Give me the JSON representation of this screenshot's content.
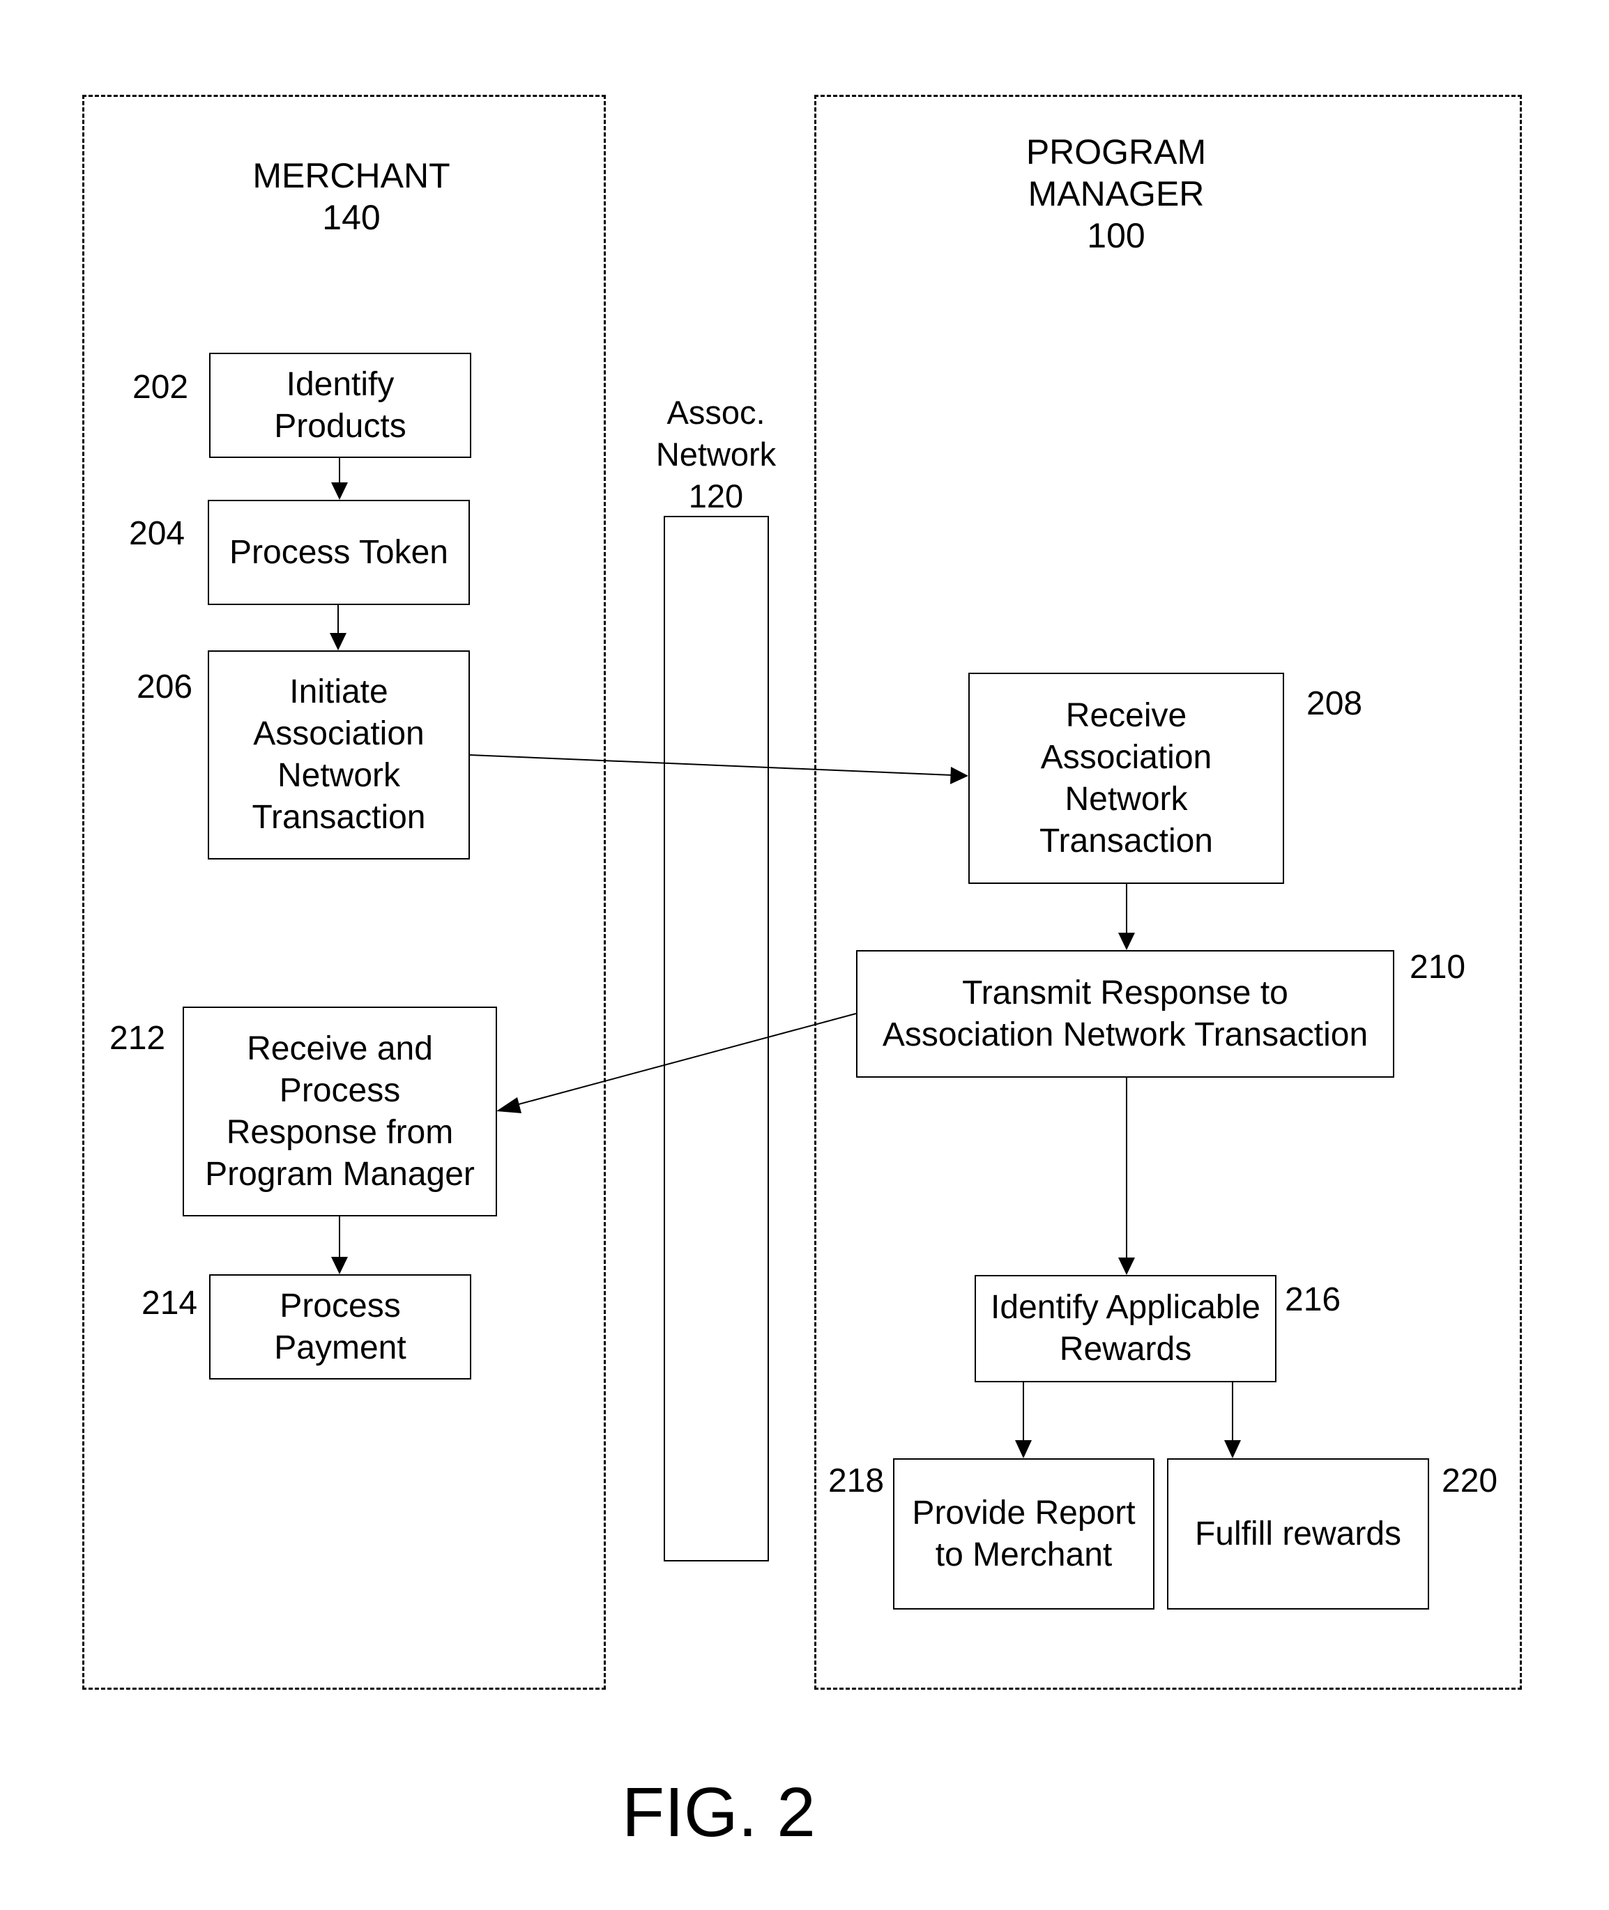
{
  "figure_label": "FIG. 2",
  "lanes": {
    "merchant": {
      "title": "MERCHANT\n140"
    },
    "network": {
      "title": "Assoc.\nNetwork\n120"
    },
    "program_manager": {
      "title": "PROGRAM\nMANAGER\n100"
    }
  },
  "steps": {
    "s202": {
      "ref": "202",
      "label": "Identify\nProducts"
    },
    "s204": {
      "ref": "204",
      "label": "Process Token"
    },
    "s206": {
      "ref": "206",
      "label": "Initiate\nAssociation\nNetwork\nTransaction"
    },
    "s208": {
      "ref": "208",
      "label": "Receive\nAssociation\nNetwork\nTransaction"
    },
    "s210": {
      "ref": "210",
      "label": "Transmit Response to\nAssociation Network Transaction"
    },
    "s212": {
      "ref": "212",
      "label": "Receive and\nProcess\nResponse from\nProgram Manager"
    },
    "s214": {
      "ref": "214",
      "label": "Process\nPayment"
    },
    "s216": {
      "ref": "216",
      "label": "Identify Applicable\nRewards"
    },
    "s218": {
      "ref": "218",
      "label": "Provide Report\nto Merchant"
    },
    "s220": {
      "ref": "220",
      "label": "Fulfill rewards"
    }
  },
  "connections": [
    {
      "from": "202",
      "to": "204"
    },
    {
      "from": "204",
      "to": "206"
    },
    {
      "from": "206",
      "to": "208"
    },
    {
      "from": "208",
      "to": "210"
    },
    {
      "from": "210",
      "to": "212"
    },
    {
      "from": "212",
      "to": "214"
    },
    {
      "from": "210",
      "to": "216"
    },
    {
      "from": "216",
      "to": "218"
    },
    {
      "from": "216",
      "to": "220"
    }
  ]
}
